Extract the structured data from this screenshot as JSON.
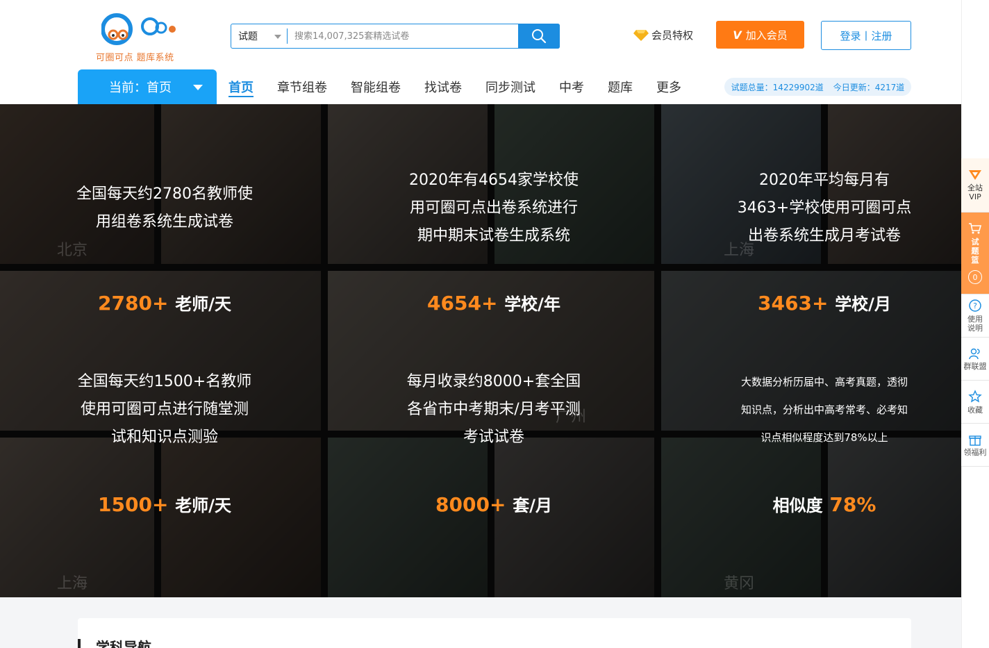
{
  "logo": {
    "text": "可圈可点 题库系统"
  },
  "search": {
    "type": "试题",
    "placeholder": "搜索14,007,325套精选试卷"
  },
  "header": {
    "vip_priv": "会员特权",
    "join": "加入会员",
    "join_v": "V",
    "login": "登录丨注册"
  },
  "nav": {
    "current": "当前：首页",
    "items": [
      "首页",
      "章节组卷",
      "智能组卷",
      "找试卷",
      "同步测试",
      "中考",
      "题库",
      "更多"
    ]
  },
  "stats": {
    "total": "试题总量：14229902道",
    "today": "今日更新：4217道"
  },
  "banner": {
    "row1": [
      {
        "lines": [
          "全国每天约2780名教师使",
          "用组卷系统生成试卷"
        ]
      },
      {
        "lines": [
          "2020年有4654家学校使",
          "用可圈可点出卷系统进行",
          "期中期末试卷生成系统"
        ]
      },
      {
        "lines": [
          "2020年平均每月有",
          "3463+学校使用可圈可点",
          "出卷系统生成月考试卷"
        ]
      }
    ],
    "row2_stats": [
      {
        "num": "2780+",
        "unit": "老师/天"
      },
      {
        "num": "4654+",
        "unit": "学校/年"
      },
      {
        "num": "3463+",
        "unit": "学校/月"
      }
    ],
    "row2_text": [
      {
        "lines": [
          "全国每天约1500+名教师",
          "使用可圈可点进行随堂测",
          "试和知识点测验"
        ]
      },
      {
        "lines": [
          "每月收录约8000+套全国",
          "各省市中考期末/月考平测",
          "考试试卷"
        ]
      },
      {
        "lines": [
          "大数据分析历届中、高考真题，透彻",
          "知识点，分析出中高考常考、必考知",
          "识点相似程度达到78%以上"
        ]
      }
    ],
    "row3_stats": [
      {
        "num": "1500+",
        "unit": "老师/天",
        "pre": ""
      },
      {
        "num": "8000+",
        "unit": "套/月",
        "pre": ""
      },
      {
        "num": "78%",
        "unit": "",
        "pre": "相似度"
      }
    ],
    "cities": [
      "北京",
      "上海",
      "广州",
      "上海",
      "黄冈"
    ]
  },
  "sidebar": {
    "vip": "全站VIP",
    "cart": "试题篮",
    "cart_count": "0",
    "help": "使用说明",
    "group": "群联盟",
    "fav": "收藏",
    "gift": "领福利"
  },
  "section": {
    "subject_title": "学科导航"
  },
  "colors": {
    "brand_blue": "#1c8de0",
    "accent_orange": "#ff7a14",
    "stat_orange": "#ff8a1e"
  }
}
